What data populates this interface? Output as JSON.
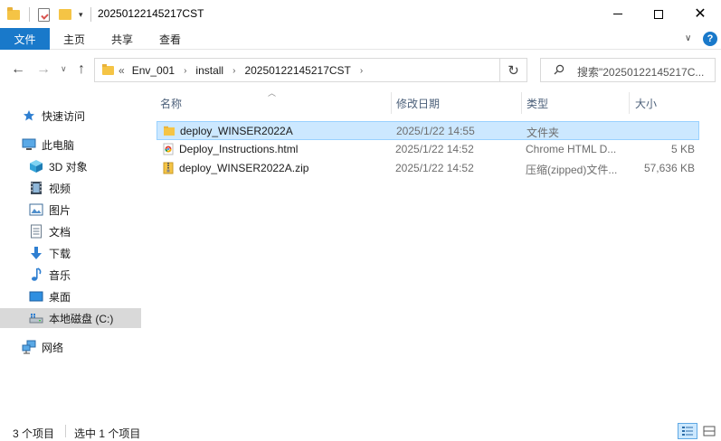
{
  "window": {
    "title": "20250122145217CST",
    "minimize_label": "",
    "maximize_label": "",
    "close_label": "✕"
  },
  "ribbon": {
    "file_tab": "文件",
    "tabs": [
      "主页",
      "共享",
      "查看"
    ],
    "expand_glyph": "∨",
    "help_glyph": "?"
  },
  "address": {
    "overflow": "«",
    "crumbs": [
      "Env_001",
      "install",
      "20250122145217CST"
    ],
    "separator": "›"
  },
  "search": {
    "placeholder": "搜索\"20250122145217C..."
  },
  "nav_pane": {
    "items": [
      {
        "label": "快速访问",
        "icon": "star-icon"
      },
      {
        "label": "此电脑",
        "icon": "computer-icon"
      },
      {
        "label": "3D 对象",
        "icon": "3d-objects-icon"
      },
      {
        "label": "视频",
        "icon": "video-icon"
      },
      {
        "label": "图片",
        "icon": "pictures-icon"
      },
      {
        "label": "文档",
        "icon": "documents-icon"
      },
      {
        "label": "下载",
        "icon": "download-icon"
      },
      {
        "label": "音乐",
        "icon": "music-icon"
      },
      {
        "label": "桌面",
        "icon": "desktop-icon"
      },
      {
        "label": "本地磁盘 (C:)",
        "icon": "drive-icon"
      },
      {
        "label": "网络",
        "icon": "network-icon"
      }
    ],
    "selected_index": 9
  },
  "columns": {
    "name": "名称",
    "date": "修改日期",
    "type": "类型",
    "size": "大小"
  },
  "files": [
    {
      "name": "deploy_WINSER2022A",
      "date": "2025/1/22 14:55",
      "type": "文件夹",
      "size": "",
      "icon": "folder-icon",
      "selected": true
    },
    {
      "name": "Deploy_Instructions.html",
      "date": "2025/1/22 14:52",
      "type": "Chrome HTML D...",
      "size": "5 KB",
      "icon": "chrome-html-icon",
      "selected": false
    },
    {
      "name": "deploy_WINSER2022A.zip",
      "date": "2025/1/22 14:52",
      "type": "压缩(zipped)文件...",
      "size": "57,636 KB",
      "icon": "zip-icon",
      "selected": false
    }
  ],
  "status": {
    "count": "3 个项目",
    "selection": "选中 1 个项目"
  },
  "colors": {
    "accent": "#1979ca",
    "selection_bg": "#cce8ff",
    "selection_border": "#99d1ff",
    "folder": "#f5c445"
  }
}
